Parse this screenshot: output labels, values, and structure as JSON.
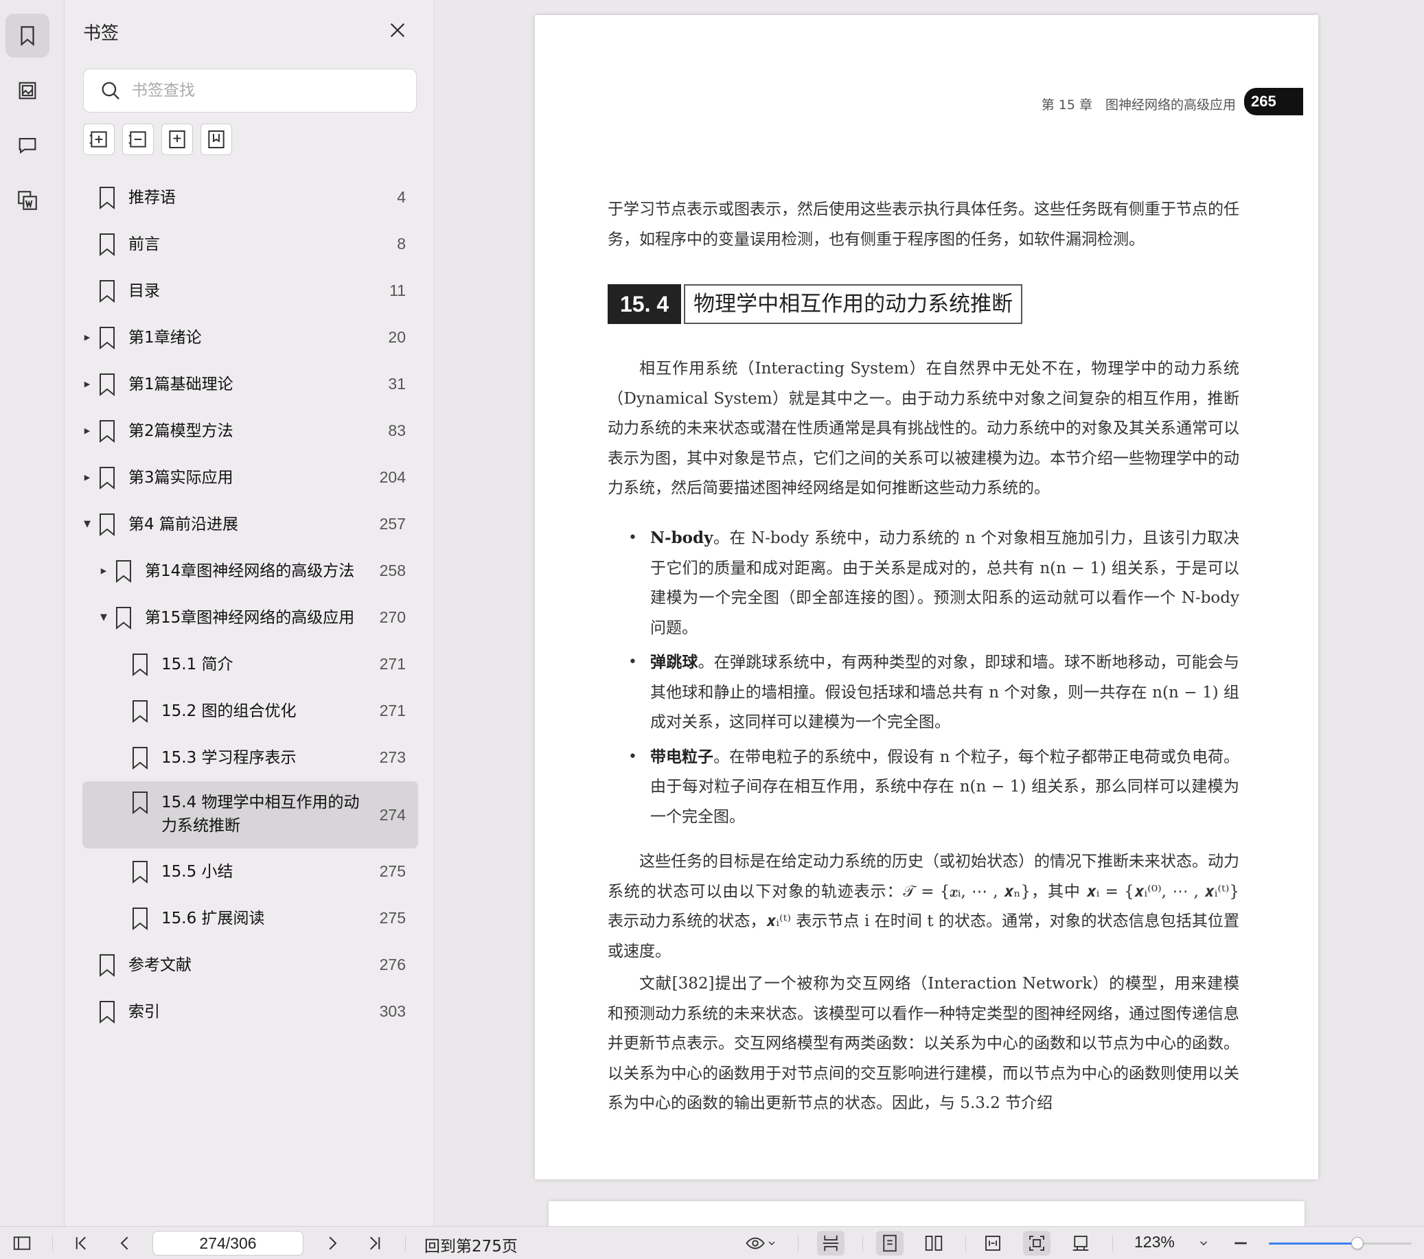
{
  "sidebar": {
    "title": "书签",
    "search_placeholder": "书签查找",
    "items": [
      {
        "label": "推荐语",
        "page": "4",
        "level": 0,
        "arrow": ""
      },
      {
        "label": "前言",
        "page": "8",
        "level": 0,
        "arrow": ""
      },
      {
        "label": "目录",
        "page": "11",
        "level": 0,
        "arrow": ""
      },
      {
        "label": "第1章绪论",
        "page": "20",
        "level": 0,
        "arrow": "collapsed"
      },
      {
        "label": "第1篇基础理论",
        "page": "31",
        "level": 0,
        "arrow": "collapsed"
      },
      {
        "label": "第2篇模型方法",
        "page": "83",
        "level": 0,
        "arrow": "collapsed"
      },
      {
        "label": "第3篇实际应用",
        "page": "204",
        "level": 0,
        "arrow": "collapsed"
      },
      {
        "label": "第4 篇前沿进展",
        "page": "257",
        "level": 0,
        "arrow": "expanded"
      },
      {
        "label": "第14章图神经网络的高级方法",
        "page": "258",
        "level": 1,
        "arrow": "collapsed"
      },
      {
        "label": "第15章图神经网络的高级应用",
        "page": "270",
        "level": 1,
        "arrow": "expanded"
      },
      {
        "label": "15.1 简介",
        "page": "271",
        "level": 2,
        "arrow": ""
      },
      {
        "label": "15.2 图的组合优化",
        "page": "271",
        "level": 2,
        "arrow": ""
      },
      {
        "label": "15.3 学习程序表示",
        "page": "273",
        "level": 2,
        "arrow": ""
      },
      {
        "label": "15.4 物理学中相互作用的动力系统推断",
        "label_line1": "15.4 物理学中相互作用的动",
        "label_line2": "力系统推断",
        "page": "274",
        "level": 2,
        "arrow": "",
        "selected": true
      },
      {
        "label": "15.5 小结",
        "page": "275",
        "level": 2,
        "arrow": ""
      },
      {
        "label": "15.6 扩展阅读",
        "page": "275",
        "level": 2,
        "arrow": ""
      },
      {
        "label": "参考文献",
        "page": "276",
        "level": 0,
        "arrow": ""
      },
      {
        "label": "索引",
        "page": "303",
        "level": 0,
        "arrow": ""
      }
    ]
  },
  "page": {
    "running_head": "第 15 章　图神经网络的高级应用",
    "page_number": "265",
    "para_intro": "于学习节点表示或图表示，然后使用这些表示执行具体任务。这些任务既有侧重于节点的任务，如程序中的变量误用检测，也有侧重于程序图的任务，如软件漏洞检测。",
    "section_number": "15. 4",
    "section_title": "物理学中相互作用的动力系统推断",
    "para_1": "相互作用系统（Interacting System）在自然界中无处不在，物理学中的动力系统（Dynamical System）就是其中之一。由于动力系统中对象之间复杂的相互作用，推断动力系统的未来状态或潜在性质通常是具有挑战性的。动力系统中的对象及其关系通常可以表示为图，其中对象是节点，它们之间的关系可以被建模为边。本节介绍一些物理学中的动力系统，然后简要描述图神经网络是如何推断这些动力系统的。",
    "bullets": [
      {
        "term": "N-body",
        "text": "。在 N-body 系统中，动力系统的 n 个对象相互施加引力，且该引力取决于它们的质量和成对距离。由于关系是成对的，总共有 n(n − 1) 组关系，于是可以建模为一个完全图（即全部连接的图）。预测太阳系的运动就可以看作一个 N-body 问题。"
      },
      {
        "term": "弹跳球",
        "text": "。在弹跳球系统中，有两种类型的对象，即球和墙。球不断地移动，可能会与其他球和静止的墙相撞。假设包括球和墙总共有 n 个对象，则一共存在 n(n − 1) 组成对关系，这同样可以建模为一个完全图。"
      },
      {
        "term": "带电粒子",
        "text": "。在带电粒子的系统中，假设有 n 个粒子，每个粒子都带正电荷或负电荷。由于每对粒子间存在相互作用，系统中存在 n(n − 1) 组关系，那么同样可以建模为一个完全图。"
      }
    ],
    "para_2": "这些任务的目标是在给定动力系统的历史（或初始状态）的情况下推断未来状态。动力系统的状态可以由以下对象的轨迹表示：𝒯 = {𝒙ᵢ, ⋯ , 𝒙ₙ}，其中 𝒙ᵢ = {𝒙ᵢ⁽⁰⁾, ⋯ , 𝒙ᵢ⁽ᵗ⁾} 表示动力系统的状态，𝒙ᵢ⁽ᵗ⁾ 表示节点 i 在时间 t 的状态。通常，对象的状态信息包括其位置或速度。",
    "para_3": "文献[382]提出了一个被称为交互网络（Interaction Network）的模型，用来建模和预测动力系统的未来状态。该模型可以看作一种特定类型的图神经网络，通过图传递信息并更新节点表示。交互网络模型有两类函数：以关系为中心的函数和以节点为中心的函数。以关系为中心的函数用于对节点间的交互影响进行建模，而以节点为中心的函数则使用以关系为中心的函数的输出更新节点的状态。因此，与 5.3.2 节介绍"
  },
  "statusbar": {
    "page_field": "274/306",
    "goto_label": "回到第275页",
    "zoom_label": "123%",
    "zoom_fraction": 0.62
  },
  "colors": {
    "accent": "#3d7ff0",
    "selected_bg": "#d8d5d8"
  }
}
